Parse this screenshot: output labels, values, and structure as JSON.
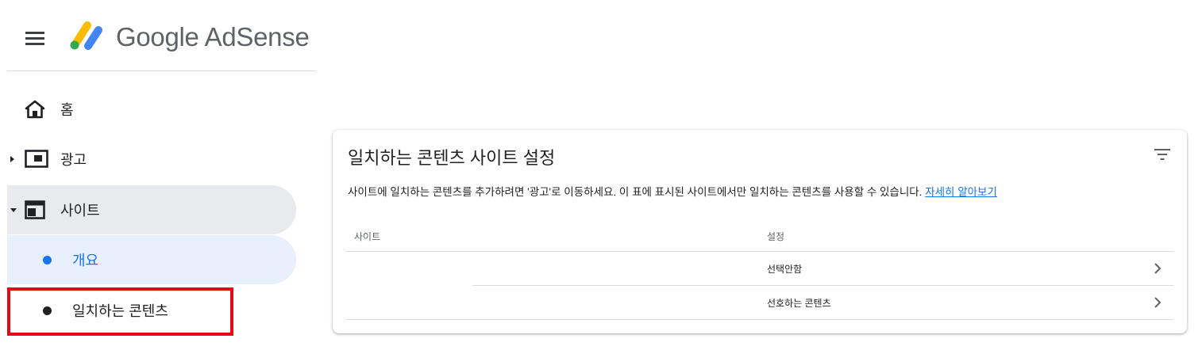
{
  "header": {
    "menu_icon": "menu-icon",
    "logo_text": "Google AdSense",
    "logo_colors": [
      "#fbbc04",
      "#4285f4",
      "#34a853"
    ]
  },
  "sidebar": {
    "items": [
      {
        "label": "홈",
        "icon": "home-icon"
      },
      {
        "label": "광고",
        "icon": "ads-icon",
        "expand": "collapsed"
      },
      {
        "label": "사이트",
        "icon": "sites-icon",
        "expand": "expanded"
      },
      {
        "label": "개요",
        "selected": true
      },
      {
        "label": "일치하는 콘텐츠"
      }
    ],
    "selected_color": "#1a73e8",
    "highlight_color": "#e50914"
  },
  "card": {
    "title": "일치하는 콘텐츠 사이트 설정",
    "filter_icon": "filter-icon",
    "description": "사이트에 일치하는 콘텐츠를 추가하려면 '광고'로 이동하세요. 이 표에 표시된 사이트에서만 일치하는 콘텐츠를 사용할 수 있습니다. ",
    "learn_more": "자세히 알아보기",
    "table": {
      "columns": [
        "사이트",
        "설정"
      ],
      "rows": [
        {
          "site": "",
          "setting": "선택안함"
        },
        {
          "site": "",
          "setting": "선호하는 콘텐츠"
        }
      ]
    }
  }
}
